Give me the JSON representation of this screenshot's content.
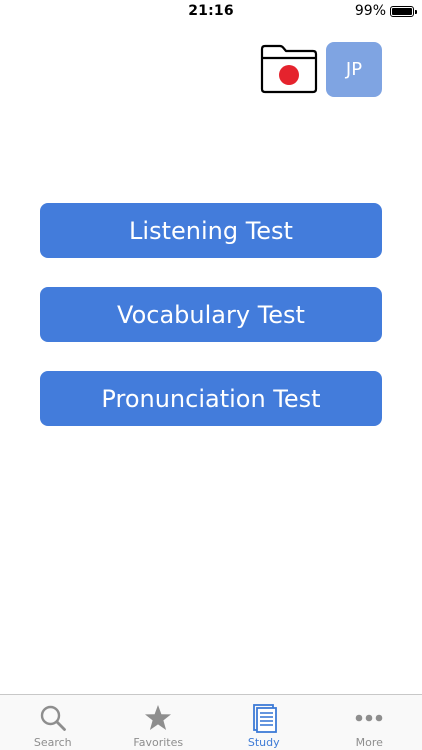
{
  "status_bar": {
    "time": "21:16",
    "battery_percent": "99%",
    "battery_level": 0.99
  },
  "header": {
    "folder_icon": "folder-with-japan-flag-icon",
    "language_button_label": "JP"
  },
  "tests": {
    "listening_label": "Listening Test",
    "vocabulary_label": "Vocabulary Test",
    "pronunciation_label": "Pronunciation Test"
  },
  "tab_bar": {
    "active_tab": "Study",
    "tabs": [
      {
        "label": "Search",
        "icon": "search-icon"
      },
      {
        "label": "Favorites",
        "icon": "star-icon"
      },
      {
        "label": "Study",
        "icon": "study-notebook-icon"
      },
      {
        "label": "More",
        "icon": "more-dots-icon"
      }
    ]
  },
  "colors": {
    "primary_button": "#437cdb",
    "language_button": "#7fa4e2",
    "active_tab": "#3e7bd6",
    "inactive_tab": "#8e8e8e",
    "flag_red": "#e5232d"
  }
}
